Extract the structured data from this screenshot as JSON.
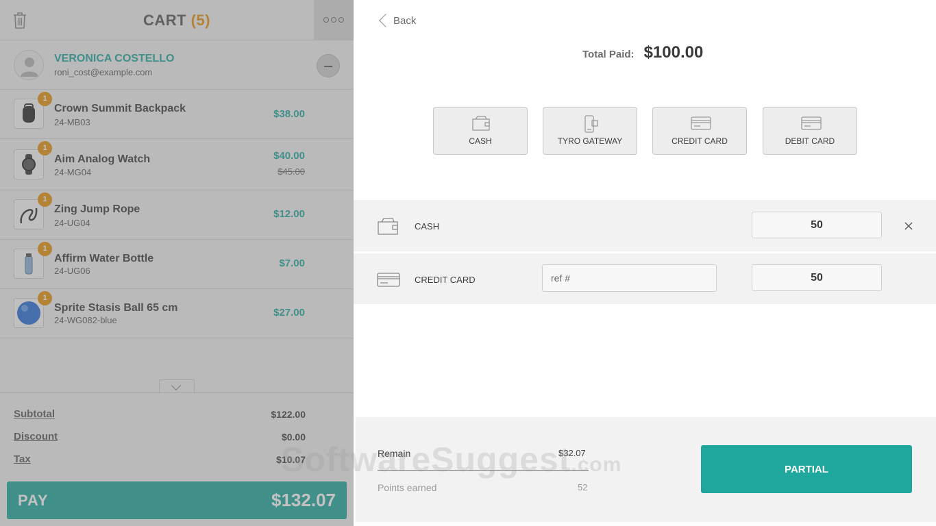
{
  "cart": {
    "title": "CART",
    "count": "(5)",
    "customer": {
      "name": "VERONICA COSTELLO",
      "email": "roni_cost@example.com"
    },
    "items": [
      {
        "qty": "1",
        "name": "Crown Summit Backpack",
        "sku": "24-MB03",
        "price": "$38.00",
        "old_price": ""
      },
      {
        "qty": "1",
        "name": "Aim Analog Watch",
        "sku": "24-MG04",
        "price": "$40.00",
        "old_price": "$45.00"
      },
      {
        "qty": "1",
        "name": "Zing Jump Rope",
        "sku": "24-UG04",
        "price": "$12.00",
        "old_price": ""
      },
      {
        "qty": "1",
        "name": "Affirm Water Bottle",
        "sku": "24-UG06",
        "price": "$7.00",
        "old_price": ""
      },
      {
        "qty": "1",
        "name": "Sprite Stasis Ball 65 cm",
        "sku": "24-WG082-blue",
        "price": "$27.00",
        "old_price": ""
      }
    ],
    "totals": {
      "subtotal_label": "Subtotal",
      "subtotal": "$122.00",
      "discount_label": "Discount",
      "discount": "$0.00",
      "tax_label": "Tax",
      "tax": "$10.07"
    },
    "pay": {
      "label": "PAY",
      "amount": "$132.07"
    }
  },
  "payment": {
    "back_label": "Back",
    "total_paid_label": "Total Paid:",
    "total_paid_value": "$100.00",
    "methods": [
      "CASH",
      "TYRO GATEWAY",
      "CREDIT CARD",
      "DEBIT CARD"
    ],
    "rows": [
      {
        "label": "CASH",
        "amount": "50",
        "icon": "wallet-icon"
      },
      {
        "label": "CREDIT CARD",
        "amount": "50",
        "ref_placeholder": "ref #",
        "icon": "credit-card-icon"
      }
    ],
    "remain_label": "Remain",
    "remain_value": "$32.07",
    "points_label": "Points earned",
    "points_value": "52",
    "partial_label": "PARTIAL"
  },
  "watermark": {
    "main": "SoftwareSuggest",
    "suffix": ".com"
  },
  "colors": {
    "accent": "#1fa79e",
    "badge": "#e7930d"
  }
}
